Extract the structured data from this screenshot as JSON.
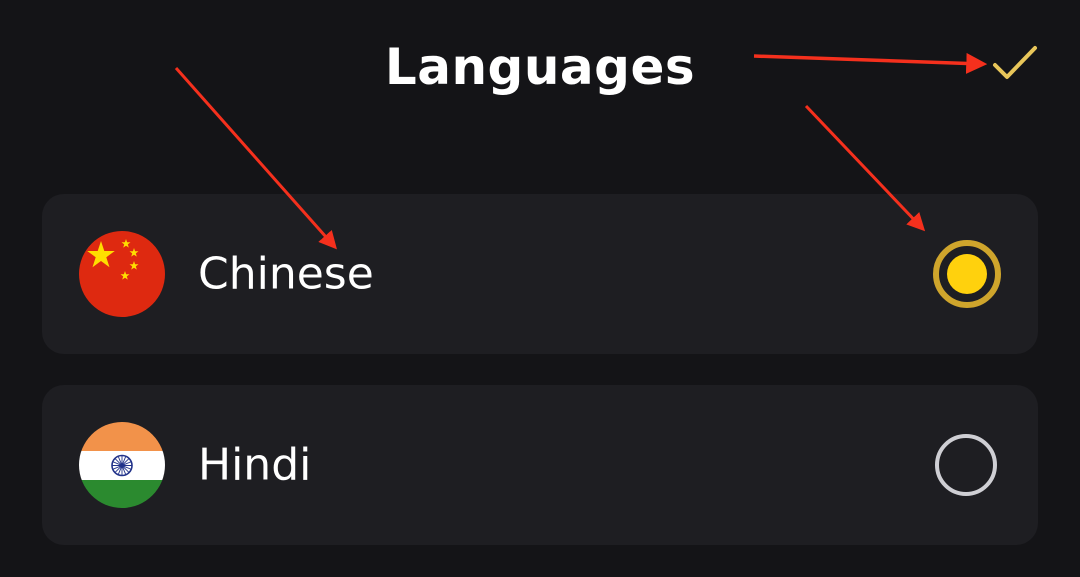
{
  "header": {
    "title": "Languages",
    "confirm_icon": "checkmark-icon",
    "confirm_color": "#e8c65a"
  },
  "languages": [
    {
      "label": "Chinese",
      "flag_icon": "china-flag-icon",
      "selected": true
    },
    {
      "label": "Hindi",
      "flag_icon": "india-flag-icon",
      "selected": false
    }
  ],
  "colors": {
    "background": "#141417",
    "row_background": "#1e1e22",
    "accent_ring": "#cfa52c",
    "accent_fill": "#ffd10d",
    "radio_unselected": "#cfcfd4",
    "annotation_arrow": "#f5301d"
  }
}
